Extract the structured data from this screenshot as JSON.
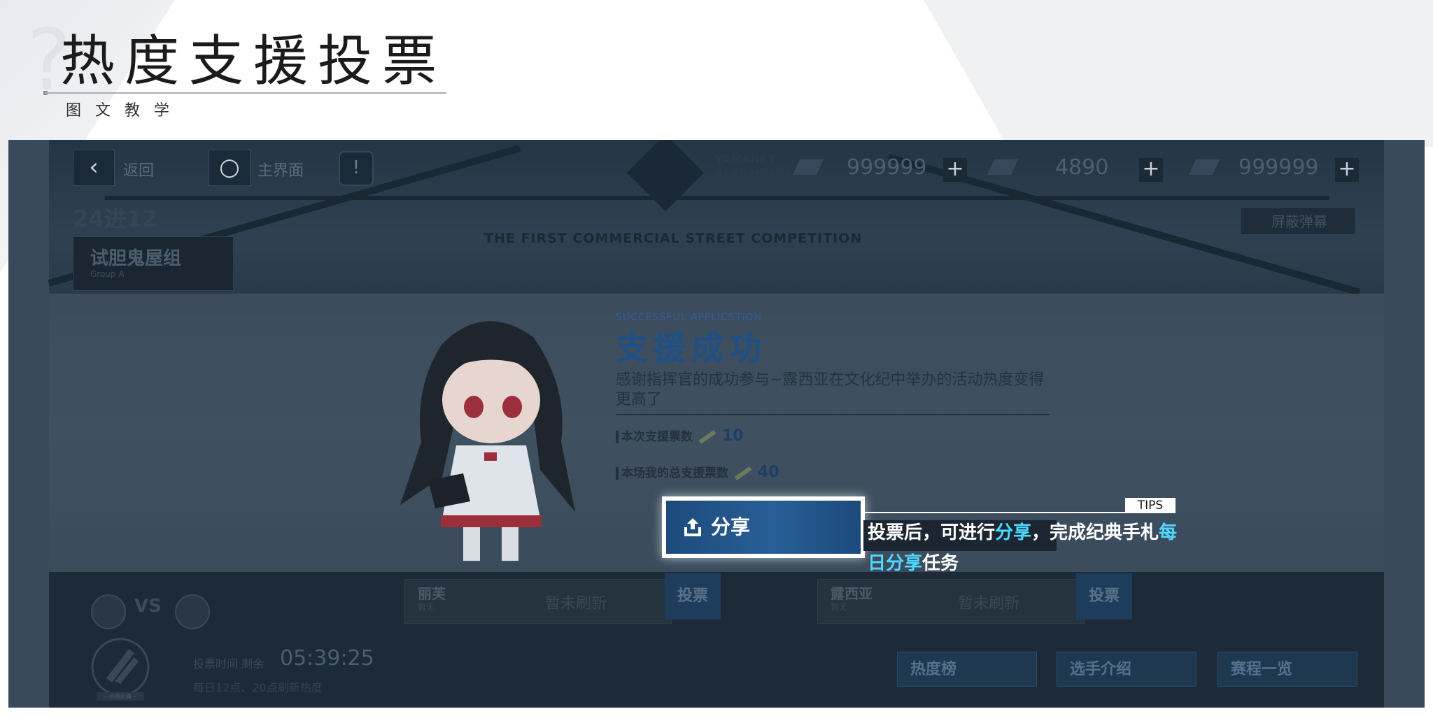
{
  "header": {
    "title": "热度支援投票",
    "subtitle": "图文教学"
  },
  "game": {
    "topbar": {
      "back_label": "返回",
      "home_label": "主界面",
      "currencies": [
        {
          "icon": "currency-a-icon",
          "value": "999999"
        },
        {
          "icon": "currency-b-icon",
          "value": "4890"
        },
        {
          "icon": "currency-c-icon",
          "value": "999999"
        }
      ],
      "logo_text_1": "YAMANEY",
      "logo_text_2": "ALKOMSSEX"
    },
    "stage_caption": "THE FIRST COMMERCIAL STREET COMPETITION",
    "block_barrage_label": "屏蔽弹幕",
    "round_label": "24进12",
    "group": {
      "name": "试胆鬼屋组",
      "sub": "Group A"
    },
    "modal": {
      "kicker": "SUCCESSFUL APPLICSTION",
      "title": "支援成功",
      "description": "感谢指挥官的成功参与~露西亚在文化纪中举办的活动热度变得更高了",
      "this_vote_label": "本次支援票数",
      "this_vote_value": "10",
      "total_vote_label": "本场我的总支援票数",
      "total_vote_value": "40",
      "share_label": "分享"
    },
    "tips": {
      "tag": "TIPS",
      "part1": "投票后，可进行",
      "hl1": "分享",
      "part2": "，完成纪典手札",
      "hl2": "每日分享",
      "part3": "任务"
    },
    "contestants": [
      {
        "name": "丽芙",
        "sub": "暂无",
        "status": "暂未刷新",
        "vote": "投票"
      },
      {
        "name": "露西亚",
        "sub": "暂无",
        "status": "暂未刷新",
        "vote": "投票"
      }
    ],
    "vs_label": "VS",
    "timer_label": "投票时间 剩余",
    "timer_value": "05:39:25",
    "timer_note": "每日12点、20点刷新热度",
    "menu": [
      "热度榜",
      "选手介绍",
      "赛程一览"
    ],
    "emblem_text": "—共鸣纪典—"
  },
  "colors": {
    "accent": "#4fd9ff",
    "modal_title": "#1e4f85",
    "share_button": "#285f96"
  }
}
